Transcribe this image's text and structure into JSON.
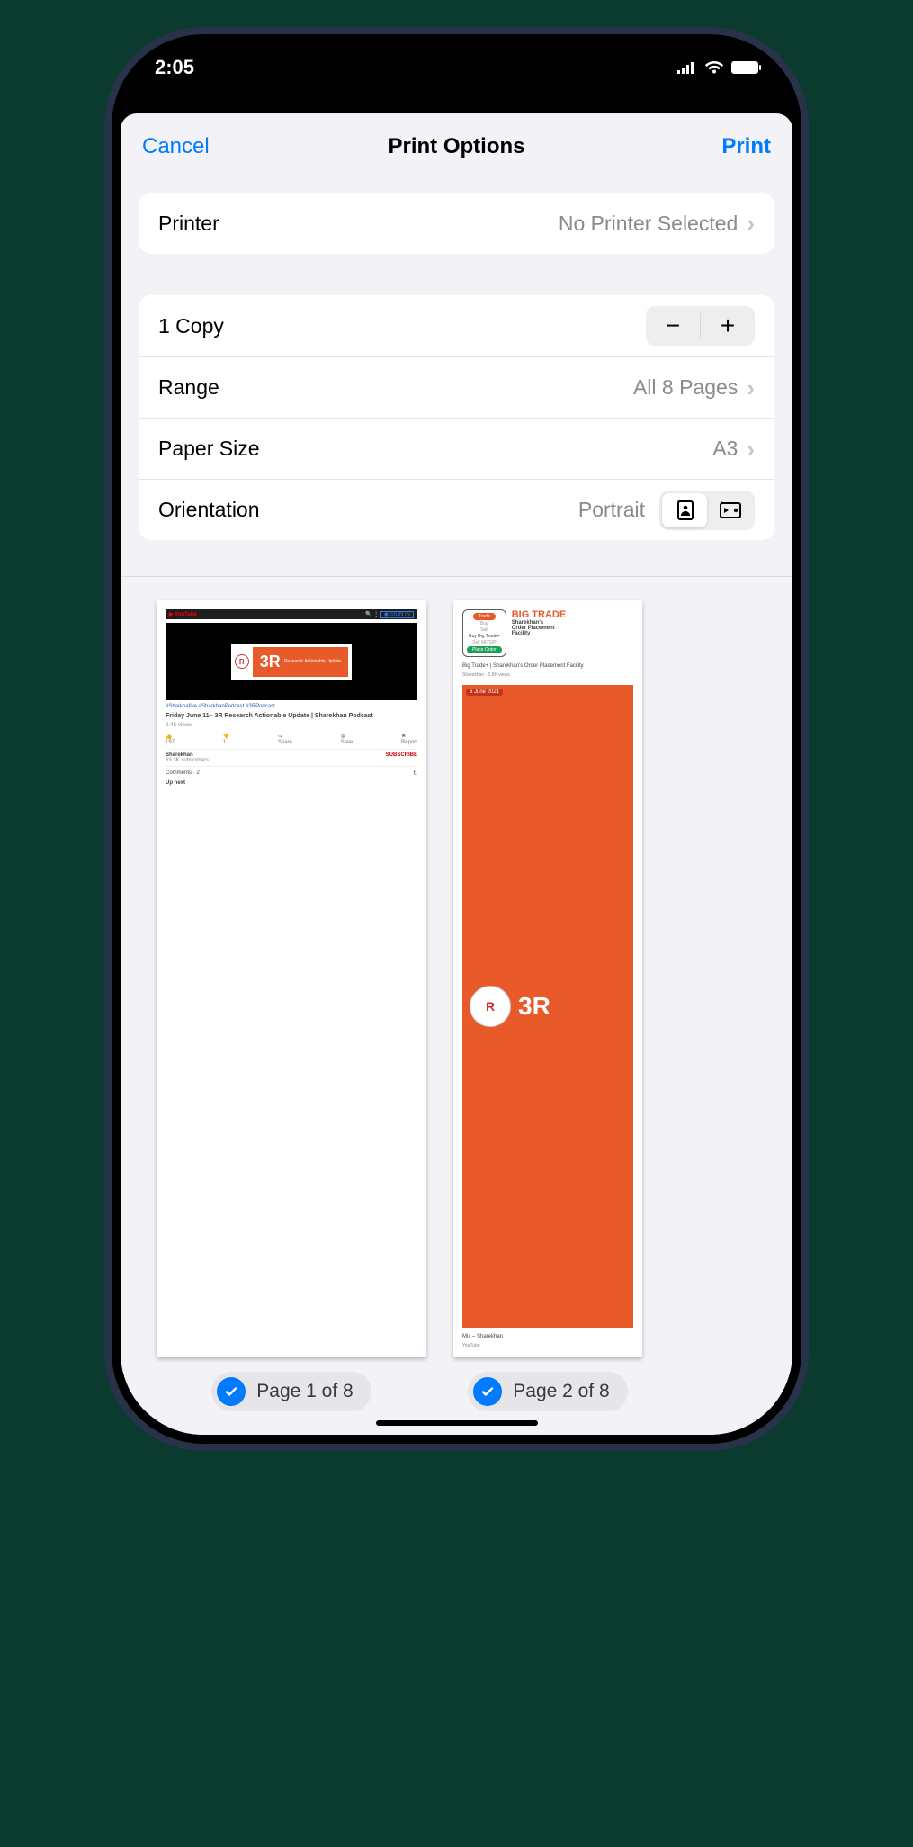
{
  "statusbar": {
    "time": "2:05"
  },
  "nav": {
    "cancel": "Cancel",
    "title": "Print Options",
    "print": "Print"
  },
  "printer": {
    "label": "Printer",
    "value": "No Printer Selected"
  },
  "copies": {
    "label": "1 Copy"
  },
  "range": {
    "label": "Range",
    "value": "All 8 Pages"
  },
  "paper": {
    "label": "Paper Size",
    "value": "A3"
  },
  "orientation": {
    "label": "Orientation",
    "value": "Portrait"
  },
  "previews": {
    "page1": {
      "video_text_big": "3R",
      "video_text_small": "Research Actionable Update",
      "tags": "#Sharkhafive   #SharkhanPodcast   #3RPodcast",
      "title": "Friday June 11– 3R Research Actionable Update | Sharekhan Podcast",
      "views": "2.4K views",
      "like": "197",
      "dislike": "1",
      "share": "Share",
      "save": "Save",
      "report": "Report",
      "channel": "Sharekhan",
      "subs": "63.3K subscribers",
      "subscribe": "SUBSCRIBE",
      "comments": "Comments · 2",
      "upnext": "Up next",
      "pager": "Page 1 of 8"
    },
    "page2": {
      "banner_big": "BIG TRADE",
      "banner_l1": "Sharekhan's",
      "banner_l2": "Order Placement",
      "banner_l3": "Facility",
      "phone_top": "Trade",
      "phone_buy": "Buy",
      "phone_sell": "Sell",
      "phone_bigtrade": "Buy Big Trade+",
      "phone_sellmf": "Sell MF/SIP",
      "phone_btn": "Place Order",
      "caption": "Big Trade+ | Sharekhan's Order Placement Facility",
      "caption_sub": "Sharekhan · 2.8K views",
      "datechip": "6 June 2021",
      "vid_big": "3R",
      "below": "Mix – Sharekhan",
      "below_sub": "YouTube",
      "pager": "Page 2 of 8"
    }
  }
}
